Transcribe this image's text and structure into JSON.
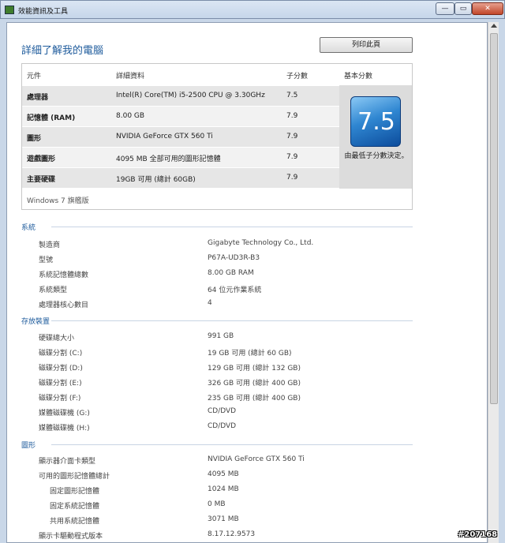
{
  "window": {
    "title": "效能資訊及工具",
    "min": "—",
    "max": "▭",
    "close": "✕"
  },
  "page": {
    "title": "詳細了解我的電腦",
    "print_label": "列印此頁"
  },
  "rating": {
    "headers": {
      "component": "元件",
      "detail": "詳細資料",
      "subscore": "子分數",
      "base": "基本分數"
    },
    "rows": [
      {
        "component": "處理器",
        "detail": "Intel(R) Core(TM) i5-2500 CPU @ 3.30GHz",
        "score": "7.5"
      },
      {
        "component": "記憶體 (RAM)",
        "detail": "8.00 GB",
        "score": "7.9"
      },
      {
        "component": "圖形",
        "detail": "NVIDIA GeForce GTX 560 Ti",
        "score": "7.9"
      },
      {
        "component": "遊戲圖形",
        "detail": "4095 MB 全部可用的圖形記憶體",
        "score": "7.9"
      },
      {
        "component": "主要硬碟",
        "detail": "19GB 可用 (總計 60GB)",
        "score": "7.9"
      }
    ],
    "base_score": "7.5",
    "base_note": "由最低子分數決定。",
    "edition": "Windows 7 旗艦版"
  },
  "system": {
    "title": "系統",
    "items": [
      {
        "label": "製造商",
        "value": "Gigabyte Technology Co., Ltd."
      },
      {
        "label": "型號",
        "value": "P67A-UD3R-B3"
      },
      {
        "label": "系統記憶體總數",
        "value": "8.00 GB RAM"
      },
      {
        "label": "系統類型",
        "value": "64 位元作業系統"
      },
      {
        "label": "處理器核心數目",
        "value": "4"
      }
    ]
  },
  "storage": {
    "title": "存放裝置",
    "items": [
      {
        "label": "硬碟總大小",
        "value": "991 GB"
      },
      {
        "label": "磁碟分割 (C:)",
        "value": "19 GB 可用 (總計 60 GB)"
      },
      {
        "label": "磁碟分割 (D:)",
        "value": "129 GB 可用 (總計 132 GB)"
      },
      {
        "label": "磁碟分割 (E:)",
        "value": "326 GB 可用 (總計 400 GB)"
      },
      {
        "label": "磁碟分割 (F:)",
        "value": "235 GB 可用 (總計 400 GB)"
      },
      {
        "label": "媒體磁碟機 (G:)",
        "value": "CD/DVD"
      },
      {
        "label": "媒體磁碟機 (H:)",
        "value": "CD/DVD"
      }
    ]
  },
  "graphics": {
    "title": "圖形",
    "items": [
      {
        "label": "顯示器介面卡類型",
        "value": "NVIDIA GeForce GTX 560 Ti"
      },
      {
        "label": "可用的圖形記憶體總計",
        "value": "4095 MB"
      },
      {
        "label": "固定圖形記憶體",
        "value": "1024 MB"
      },
      {
        "label": "固定系統記憶體",
        "value": "0 MB"
      },
      {
        "label": "共用系統記憶體",
        "value": "3071 MB"
      },
      {
        "label": "顯示卡驅動程式版本",
        "value": "8.17.12.9573"
      }
    ]
  },
  "watermark": "#207168"
}
